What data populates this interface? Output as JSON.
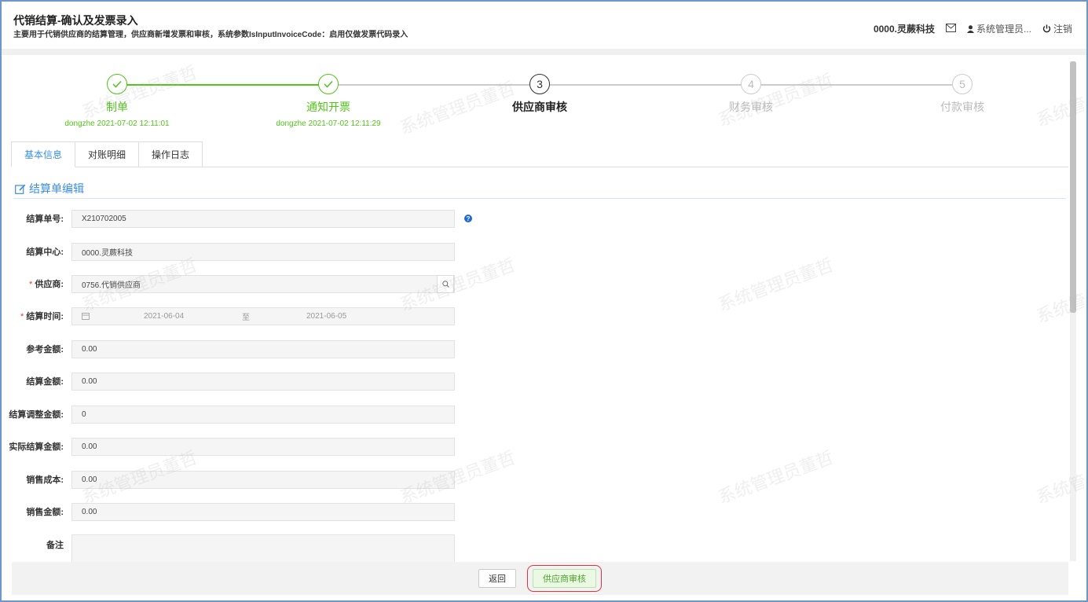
{
  "header": {
    "title": "代销结算-确认及发票录入",
    "subtitle": "主要用于代销供应商的结算管理，供应商新增发票和审核，系统参数IsInputInvoiceCode：启用仅做发票代码录入",
    "company": "0000.灵蕨科技",
    "user": "系统管理员...",
    "logout": "注销"
  },
  "steps": [
    {
      "num": "1",
      "name": "制单",
      "meta": "dongzhe 2021-07-02 12:11:01",
      "state": "done"
    },
    {
      "num": "2",
      "name": "通知开票",
      "meta": "dongzhe 2021-07-02 12:11:29",
      "state": "done"
    },
    {
      "num": "3",
      "name": "供应商审核",
      "meta": "",
      "state": "current"
    },
    {
      "num": "4",
      "name": "财务审核",
      "meta": "",
      "state": "todo"
    },
    {
      "num": "5",
      "name": "付款审核",
      "meta": "",
      "state": "todo"
    }
  ],
  "tabs": [
    "基本信息",
    "对账明细",
    "操作日志"
  ],
  "section_title": "结算单编辑",
  "form": {
    "settle_no": {
      "label": "结算单号:",
      "value": "X210702005"
    },
    "center": {
      "label": "结算中心:",
      "value": "0000.灵蕨科技"
    },
    "supplier": {
      "label": "供应商:",
      "value": "0756.代销供应商"
    },
    "period": {
      "label": "结算时间:",
      "from": "2021-06-04",
      "to_label": "至",
      "to": "2021-06-05"
    },
    "ref_amount": {
      "label": "参考金额:",
      "value": "0.00"
    },
    "settle_amount": {
      "label": "结算金额:",
      "value": "0.00"
    },
    "adjust_amount": {
      "label": "结算调整金额:",
      "value": "0"
    },
    "actual_amount": {
      "label": "实际结算金额:",
      "value": "0.00"
    },
    "sales_cost": {
      "label": "销售成本:",
      "value": "0.00"
    },
    "sales_amount": {
      "label": "销售金额:",
      "value": "0.00"
    },
    "remark": {
      "label": "备注",
      "value": ""
    }
  },
  "buttons": {
    "back": "返回",
    "approve": "供应商审核"
  },
  "watermark": "系统管理员董哲",
  "colors": {
    "done": "#52c41a",
    "accent": "#3a8ee6",
    "highlight": "#d9363e"
  }
}
